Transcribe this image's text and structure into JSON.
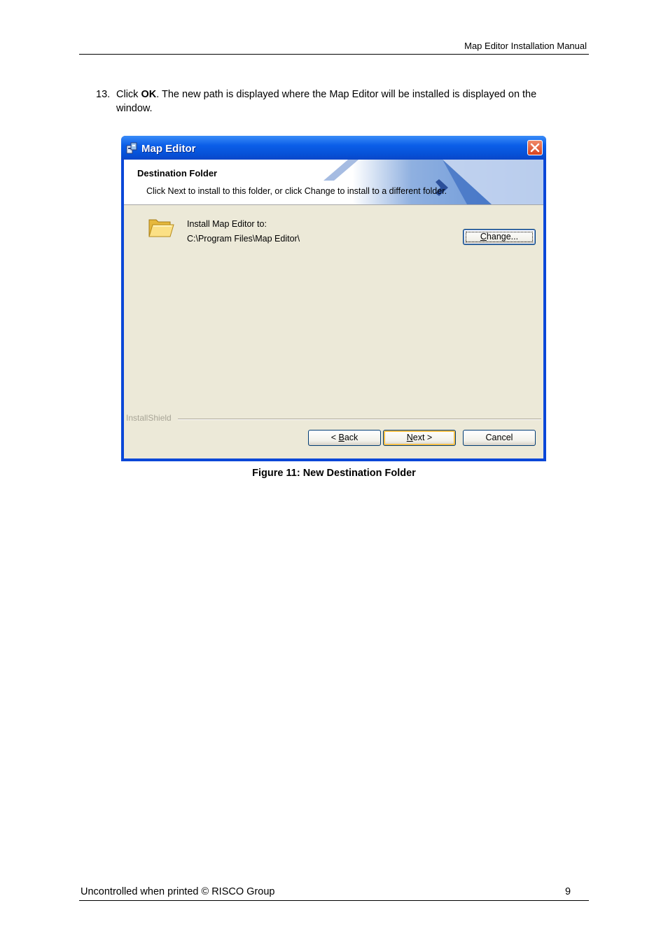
{
  "header": {
    "title": "Map Editor Installation Manual"
  },
  "step": {
    "number": "13.",
    "text_before": "Click ",
    "bold": "OK",
    "text_after": ". The new path is displayed where the Map Editor will be installed is displayed on the window."
  },
  "dialog": {
    "title": "Map Editor",
    "banner_title": "Destination Folder",
    "banner_desc": "Click Next to install to this folder, or click Change to install to a different folder.",
    "install_label": "Install Map Editor to:",
    "install_path": "C:\\Program Files\\Map Editor\\",
    "change_button": {
      "accel": "C",
      "rest": "hange..."
    },
    "installshield": "InstallShield",
    "back_button": {
      "prefix": "< ",
      "accel": "B",
      "rest": "ack"
    },
    "next_button": {
      "accel": "N",
      "rest": "ext >"
    },
    "cancel_button": "Cancel",
    "colors": {
      "titlebar": "#0650d6",
      "client": "#ece9d8",
      "close": "#d8431e"
    }
  },
  "caption": "Figure 11: New Destination Folder",
  "footer": {
    "left": "Uncontrolled when printed © RISCO Group",
    "page": "9"
  }
}
